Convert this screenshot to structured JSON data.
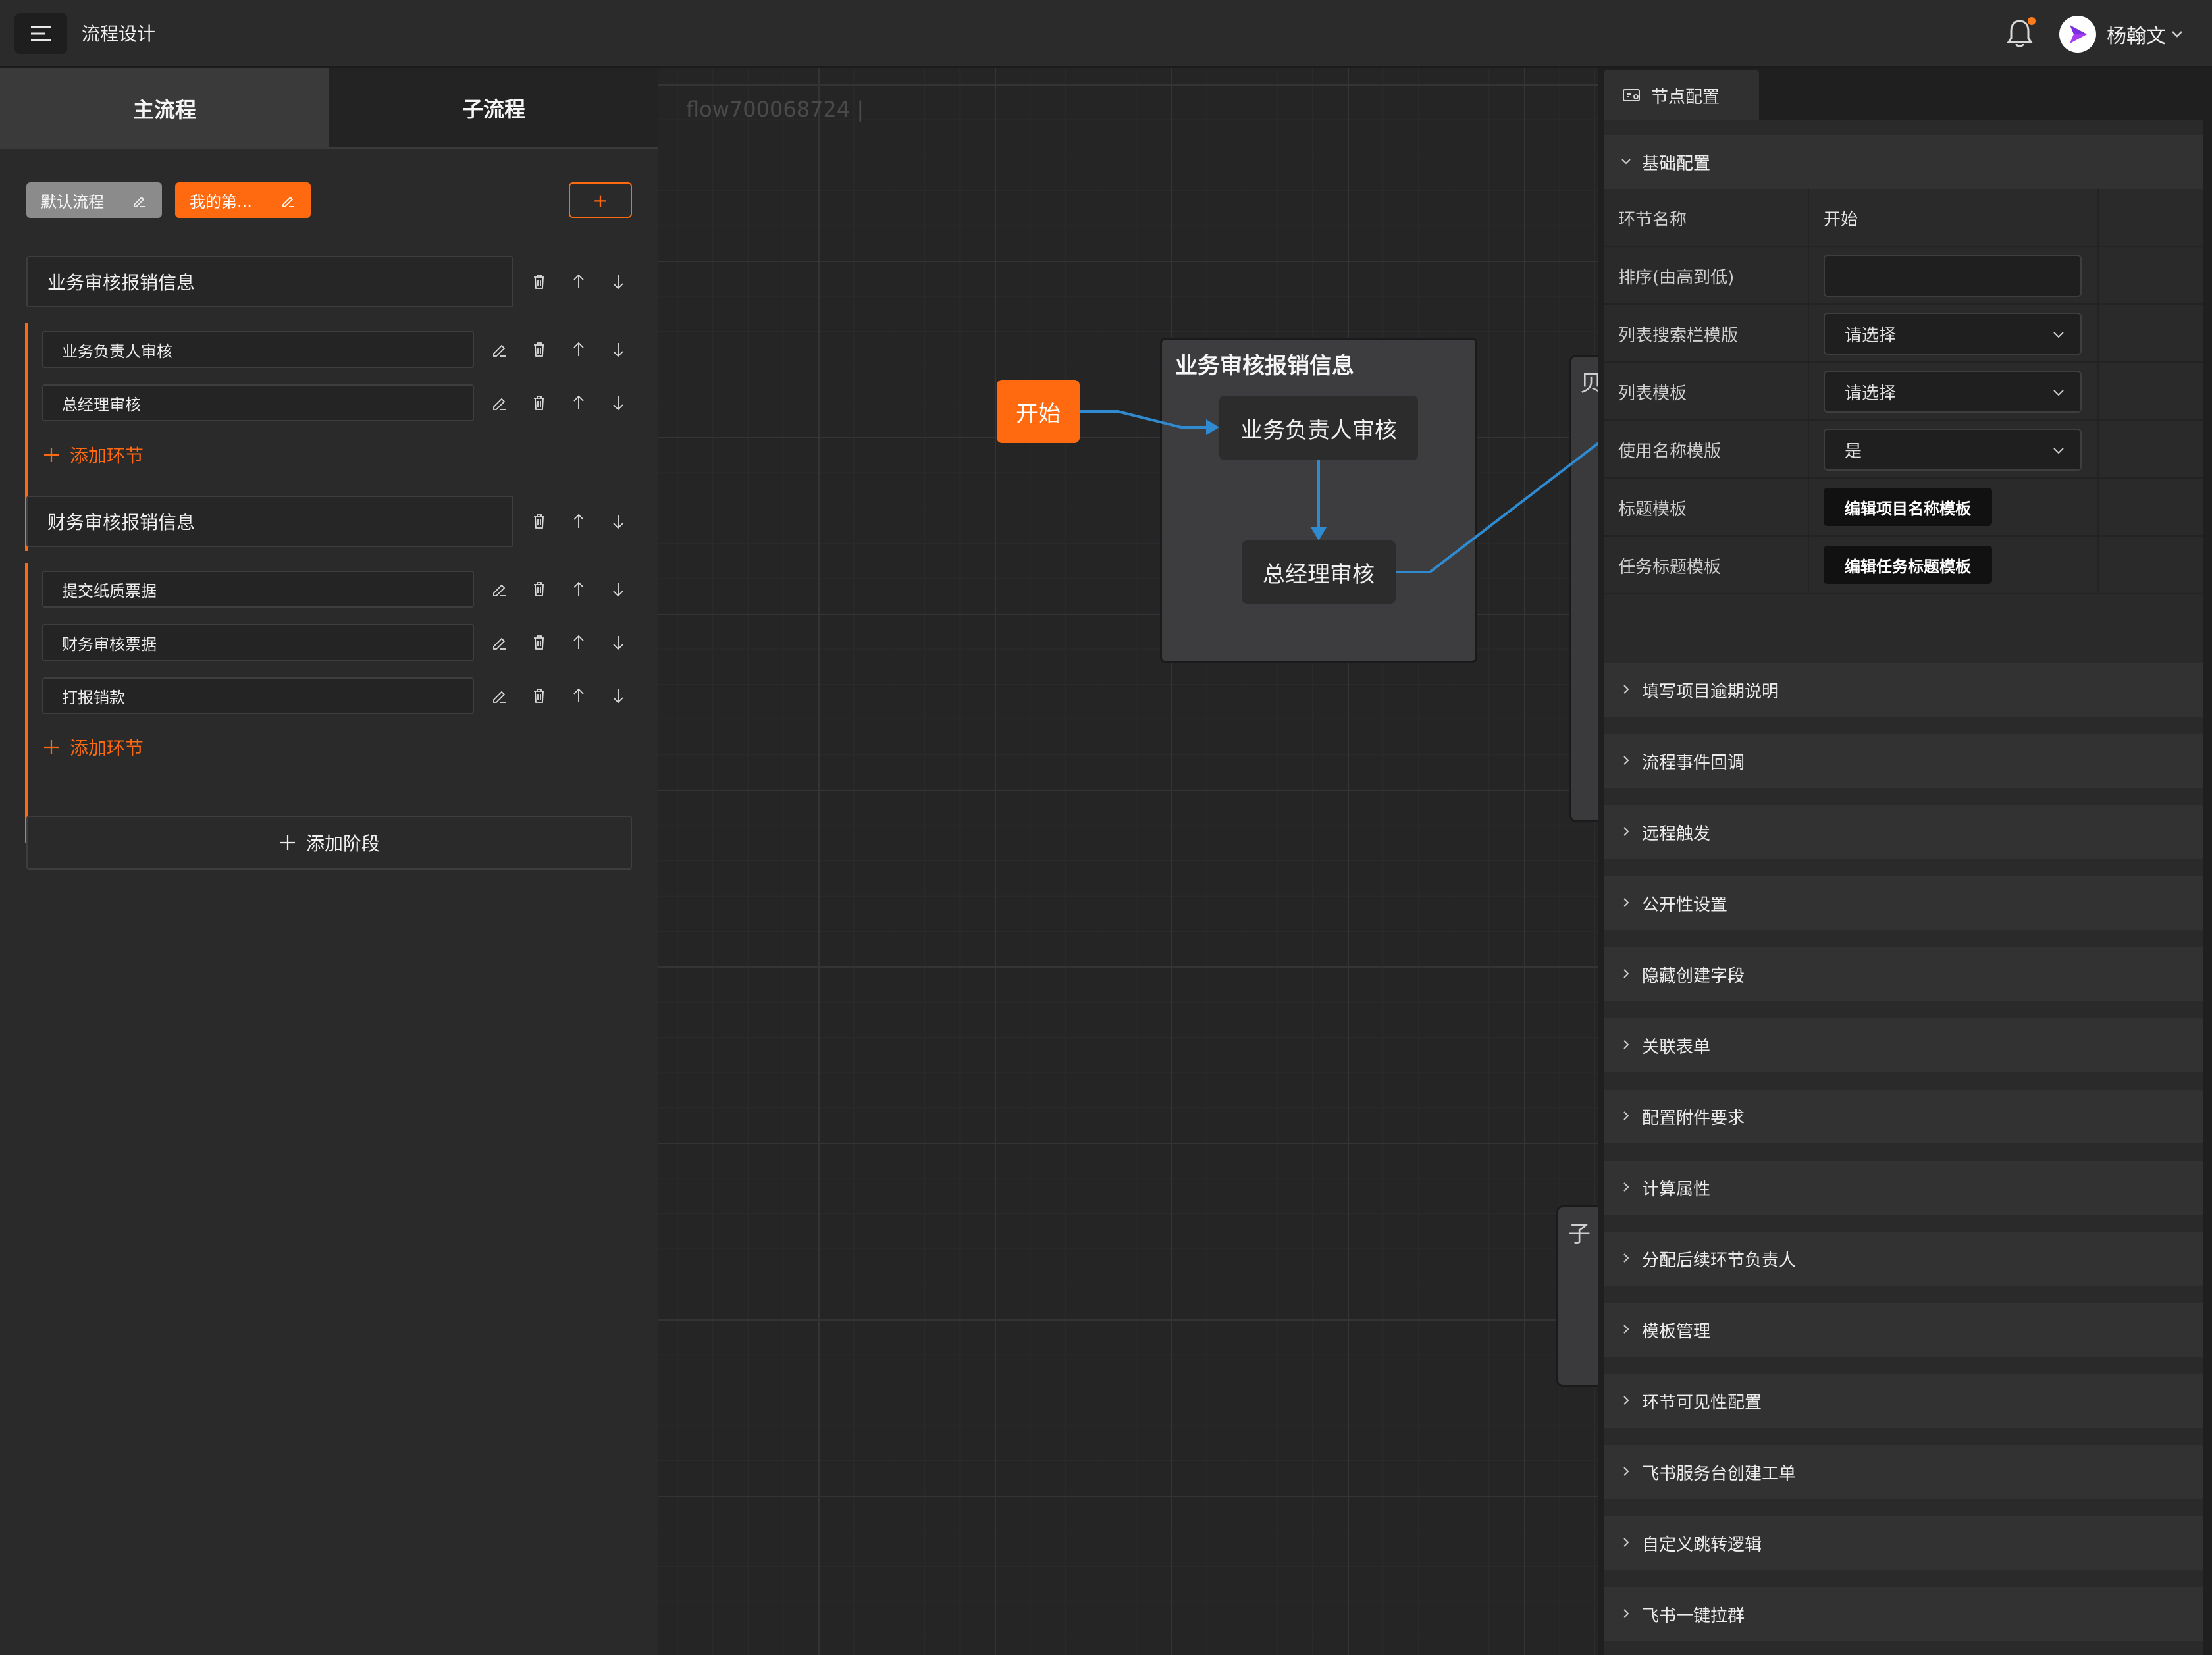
{
  "header": {
    "title": "流程设计",
    "user_name": "杨翰文"
  },
  "left": {
    "tabs": [
      {
        "label": "主流程"
      },
      {
        "label": "子流程"
      }
    ],
    "chips": {
      "default_label": "默认流程",
      "mine_label": "我的第..."
    },
    "add_flow_label": "+",
    "stages": [
      {
        "title": "业务审核报销信息",
        "items": [
          "业务负责人审核",
          "总经理审核"
        ]
      },
      {
        "title": "财务审核报销信息",
        "items": [
          "提交纸质票据",
          "财务审核票据",
          "打报销款"
        ]
      }
    ],
    "add_node_label": "添加环节",
    "add_stage_label": "添加阶段"
  },
  "canvas": {
    "flow_id": "flow700068724 |",
    "start_label": "开始",
    "group_title": "业务审核报销信息",
    "node1": "业务负责人审核",
    "node2": "总经理审核",
    "partial1": "贝",
    "partial2": "子"
  },
  "right": {
    "tab_label": "节点配置",
    "basic_section": "基础配置",
    "rows": {
      "name_label": "环节名称",
      "name_value": "开始",
      "order_label": "排序(由高到低)",
      "search_tpl_label": "列表搜索栏模版",
      "search_tpl_value": "请选择",
      "list_tpl_label": "列表模板",
      "list_tpl_value": "请选择",
      "use_name_tpl_label": "使用名称模版",
      "use_name_tpl_value": "是",
      "title_tpl_label": "标题模板",
      "title_tpl_button": "编辑项目名称模板",
      "task_title_tpl_label": "任务标题模板",
      "task_title_tpl_button": "编辑任务标题模板"
    },
    "sections": [
      "填写项目逾期说明",
      "流程事件回调",
      "远程触发",
      "公开性设置",
      "隐藏创建字段",
      "关联表单",
      "配置附件要求",
      "计算属性",
      "分配后续环节负责人",
      "模板管理",
      "环节可见性配置",
      "飞书服务台创建工单",
      "自定义跳转逻辑",
      "飞书一键拉群"
    ]
  },
  "colors": {
    "accent": "#ff6a10",
    "edge": "#2f8ad0"
  }
}
